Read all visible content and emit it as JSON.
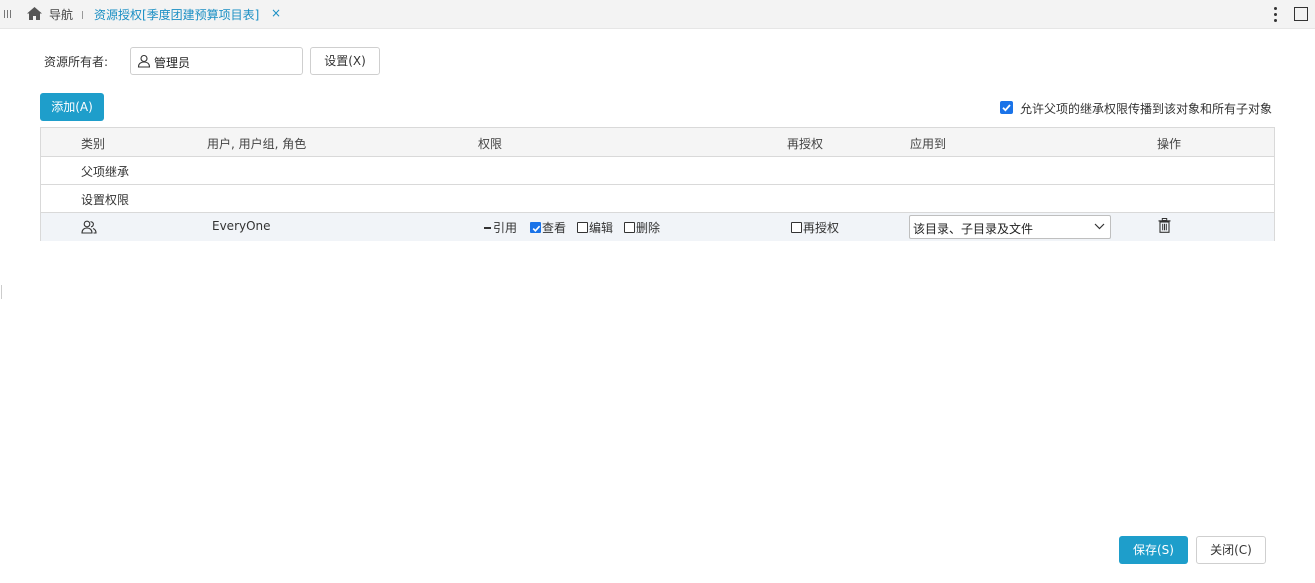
{
  "topbar": {
    "nav_label": "导航",
    "tab_title": "资源授权[季度团建预算项目表]",
    "close_glyph": "×"
  },
  "owner": {
    "label": "资源所有者:",
    "value": "管理员",
    "set_button": "设置(X)"
  },
  "actions": {
    "add_button": "添加(A)",
    "allow_inherit_label": "允许父项的继承权限传播到该对象和所有子对象",
    "allow_inherit_checked": true
  },
  "table": {
    "headers": [
      "类别",
      "用户, 用户组, 角色",
      "权限",
      "再授权",
      "应用到",
      "操作"
    ],
    "section_inherit": "父项继承",
    "section_set": "设置权限",
    "entry": {
      "category_icon": "user-group-icon",
      "principal": "EveryOne",
      "perm_ref": "引用",
      "perm_view": "查看",
      "perm_edit": "编辑",
      "perm_delete": "删除",
      "perm_view_checked": true,
      "perm_edit_checked": false,
      "perm_delete_checked": false,
      "regrant": "再授权",
      "regrant_checked": false,
      "apply_to": "该目录、子目录及文件",
      "operation_icon": "trash-icon"
    }
  },
  "footer": {
    "save_button": "保存(S)",
    "close_button": "关闭(C)"
  },
  "colors": {
    "accent": "#1e9ecb",
    "checkbox": "#1a73e8",
    "tab_text": "#1a8fc4"
  }
}
